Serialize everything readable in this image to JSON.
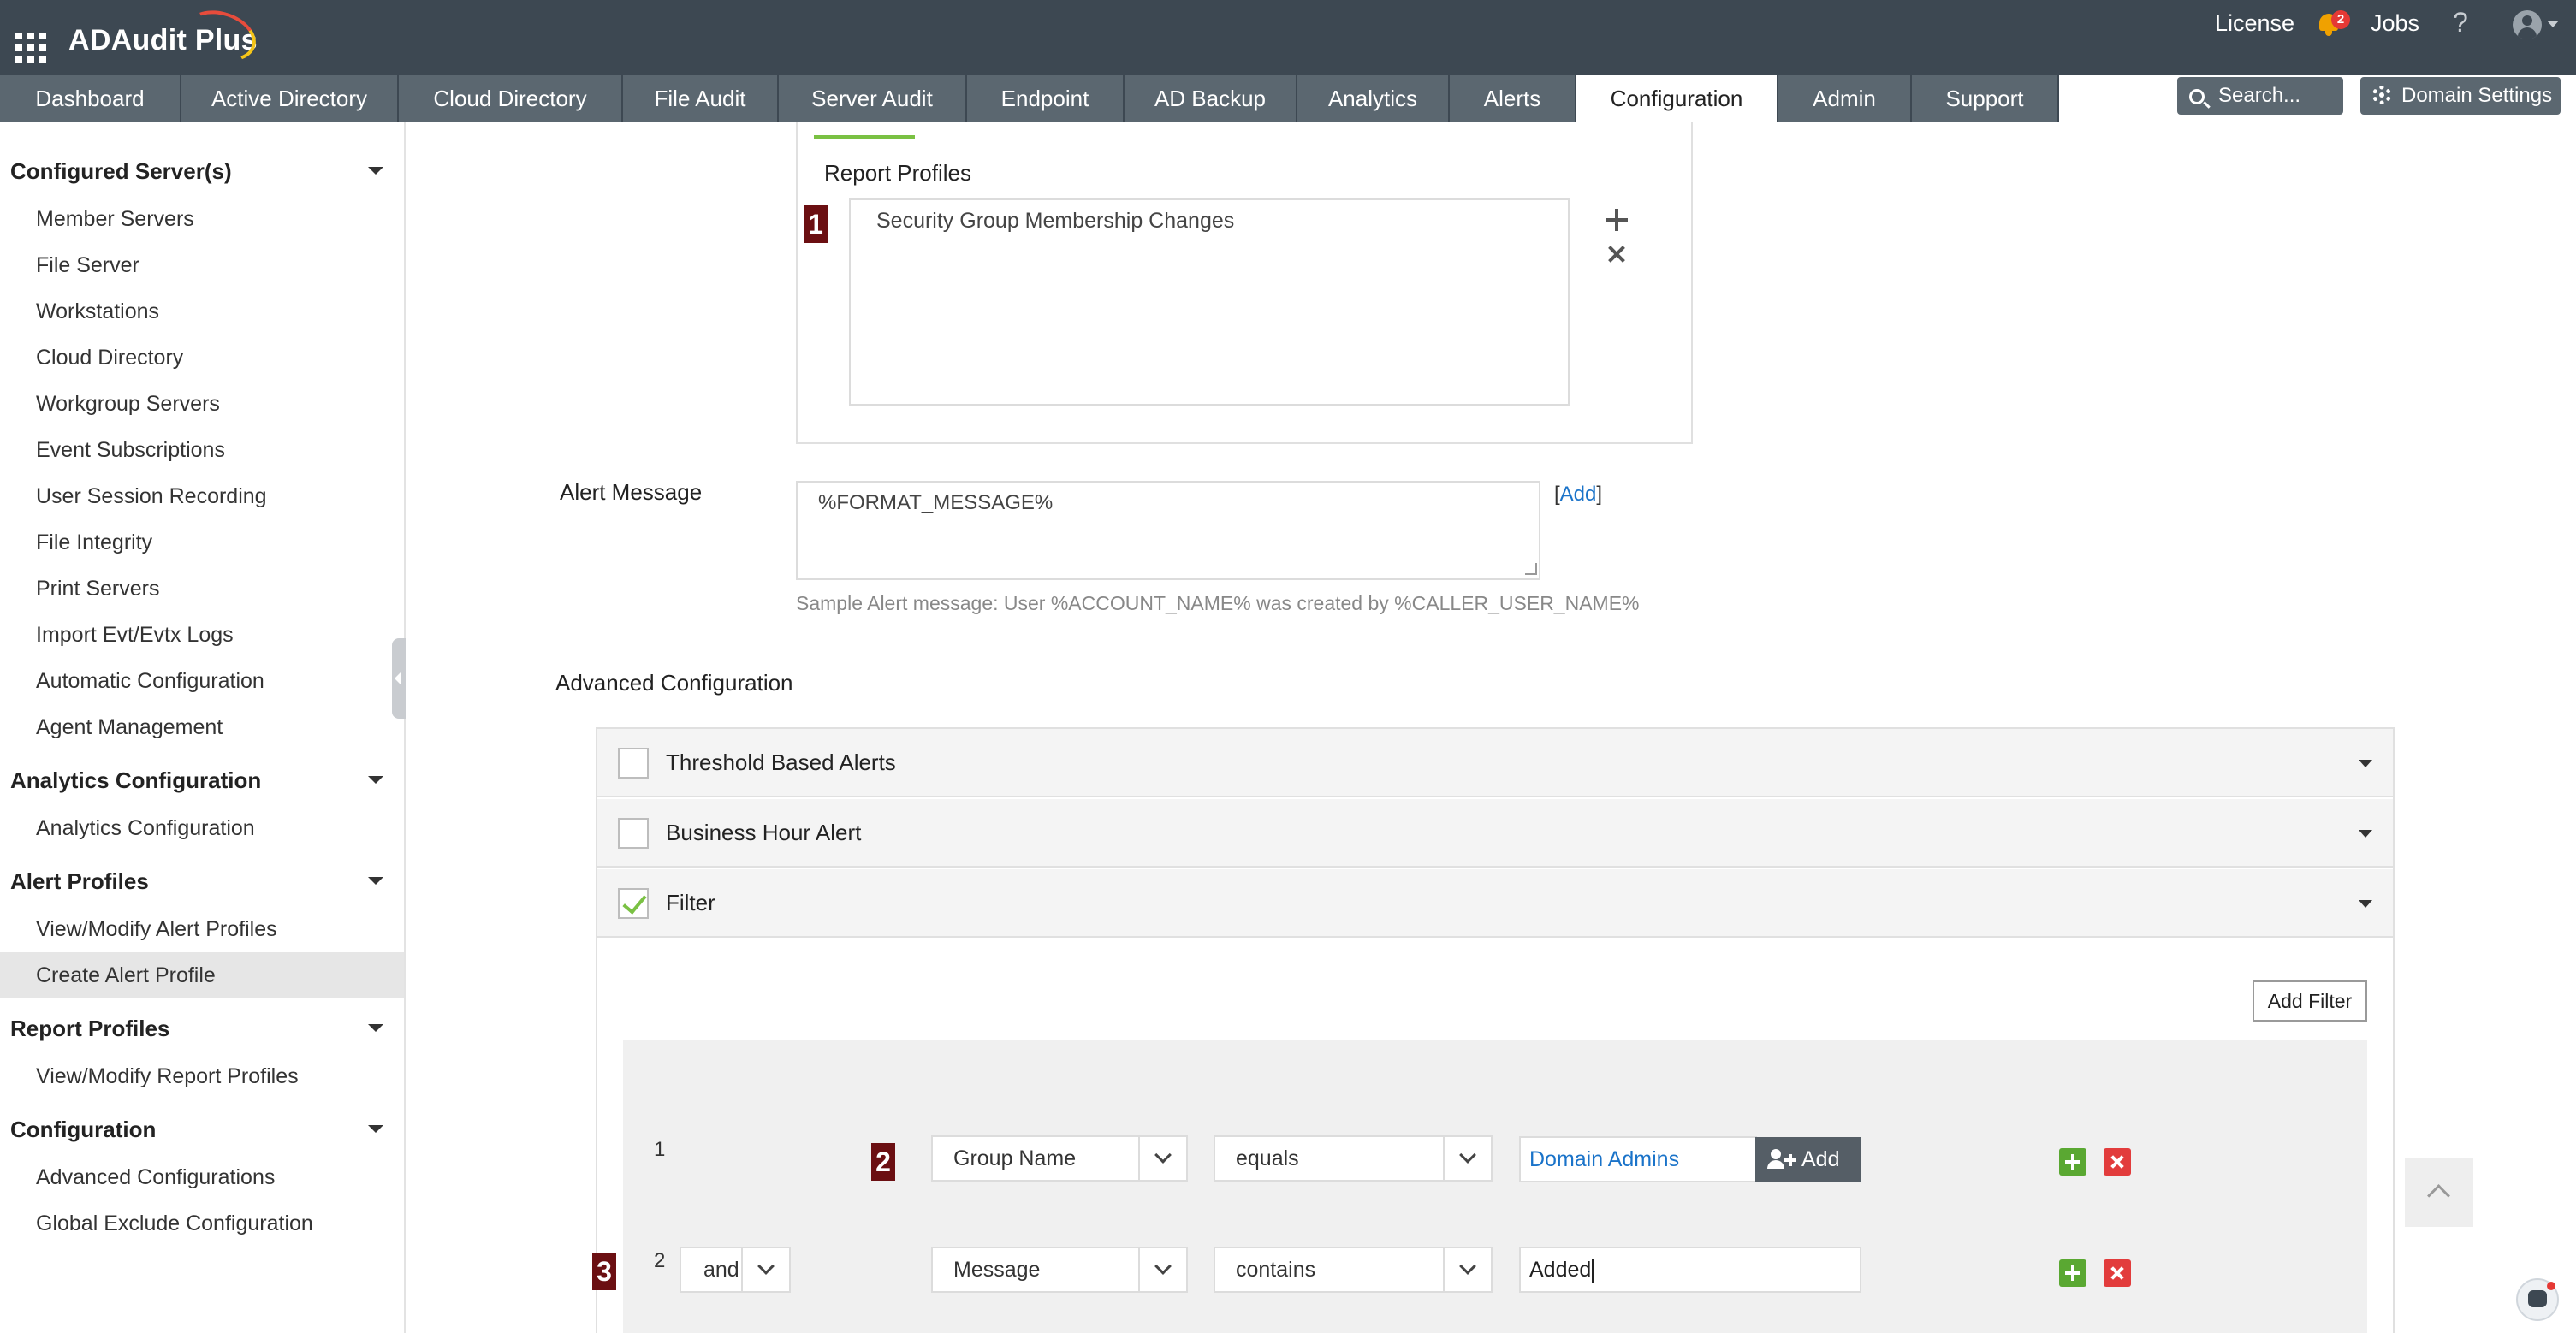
{
  "app": {
    "title": "ADAudit Plus"
  },
  "header": {
    "license": "License",
    "notifications_count": "2",
    "jobs": "Jobs",
    "help": "?"
  },
  "tabs": [
    {
      "label": "Dashboard"
    },
    {
      "label": "Active Directory"
    },
    {
      "label": "Cloud Directory"
    },
    {
      "label": "File Audit"
    },
    {
      "label": "Server Audit"
    },
    {
      "label": "Endpoint"
    },
    {
      "label": "AD Backup"
    },
    {
      "label": "Analytics"
    },
    {
      "label": "Alerts"
    },
    {
      "label": "Configuration"
    },
    {
      "label": "Admin"
    },
    {
      "label": "Support"
    }
  ],
  "active_tab": "Configuration",
  "search": {
    "placeholder": "Search..."
  },
  "domain_settings": "Domain Settings",
  "sidebar": {
    "groups": [
      {
        "title": "Configured Server(s)",
        "items": [
          "Member Servers",
          "File Server",
          "Workstations",
          "Cloud Directory",
          "Workgroup Servers",
          "Event Subscriptions",
          "User Session Recording",
          "File Integrity",
          "Print Servers",
          "Import Evt/Evtx Logs",
          "Automatic Configuration",
          "Agent Management"
        ]
      },
      {
        "title": "Analytics Configuration",
        "items": [
          "Analytics Configuration"
        ]
      },
      {
        "title": "Alert Profiles",
        "items": [
          "View/Modify Alert Profiles",
          "Create Alert Profile"
        ]
      },
      {
        "title": "Report Profiles",
        "items": [
          "View/Modify Report Profiles"
        ]
      },
      {
        "title": "Configuration",
        "items": [
          "Advanced Configurations",
          "Global Exclude Configuration"
        ]
      }
    ],
    "active_item": "Create Alert Profile"
  },
  "report_profiles": {
    "label": "Report Profiles",
    "marker": "1",
    "items": [
      "Security Group Membership Changes"
    ]
  },
  "alert_message": {
    "label": "Alert Message",
    "value": "%FORMAT_MESSAGE%",
    "add_open": "[",
    "add_link": "Add",
    "add_close": "]",
    "sample": "Sample Alert message: User %ACCOUNT_NAME% was created by %CALLER_USER_NAME%"
  },
  "advanced": {
    "label": "Advanced Configuration",
    "sections": [
      {
        "label": "Threshold Based Alerts",
        "checked": false
      },
      {
        "label": "Business Hour Alert",
        "checked": false
      },
      {
        "label": "Filter",
        "checked": true
      }
    ],
    "add_filter": "Add Filter",
    "filters": [
      {
        "num": "1",
        "marker": "2",
        "conjunction": "",
        "field": "Group Name",
        "operator": "equals",
        "value": "Domain Admins",
        "add_label": "Add"
      },
      {
        "num": "2",
        "marker": "3",
        "conjunction": "and",
        "field": "Message",
        "operator": "contains",
        "value": "Added"
      }
    ]
  },
  "colors": {
    "header_bg": "#3d4852",
    "tab_bg": "#5b6770",
    "accent_green": "#7ac143",
    "marker": "#6b0f12",
    "link": "#1a73c9"
  },
  "icons": [
    "waffle-icon",
    "bell-icon",
    "help-icon",
    "user-icon",
    "search-icon",
    "gear-icon",
    "plus-icon",
    "close-icon",
    "chevron-down-icon",
    "add-user-icon",
    "scroll-top-icon",
    "chat-bot-icon"
  ]
}
